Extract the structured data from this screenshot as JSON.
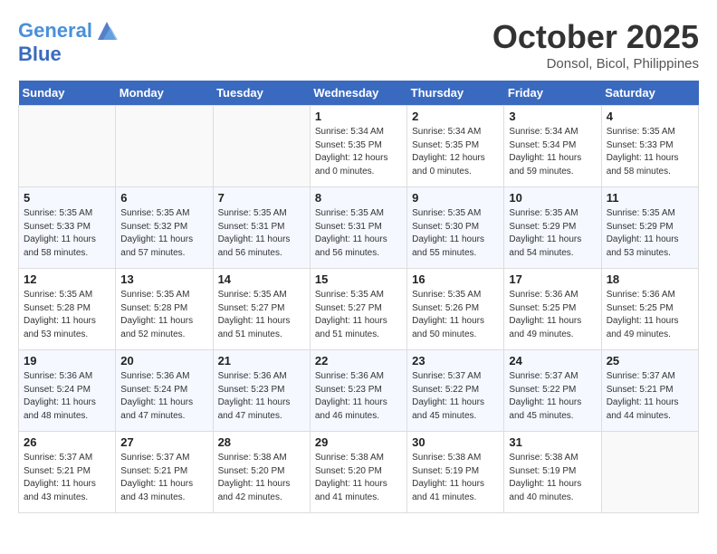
{
  "header": {
    "logo_line1": "General",
    "logo_line2": "Blue",
    "month": "October 2025",
    "location": "Donsol, Bicol, Philippines"
  },
  "weekdays": [
    "Sunday",
    "Monday",
    "Tuesday",
    "Wednesday",
    "Thursday",
    "Friday",
    "Saturday"
  ],
  "weeks": [
    [
      {
        "day": "",
        "info": ""
      },
      {
        "day": "",
        "info": ""
      },
      {
        "day": "",
        "info": ""
      },
      {
        "day": "1",
        "info": "Sunrise: 5:34 AM\nSunset: 5:35 PM\nDaylight: 12 hours\nand 0 minutes."
      },
      {
        "day": "2",
        "info": "Sunrise: 5:34 AM\nSunset: 5:35 PM\nDaylight: 12 hours\nand 0 minutes."
      },
      {
        "day": "3",
        "info": "Sunrise: 5:34 AM\nSunset: 5:34 PM\nDaylight: 11 hours\nand 59 minutes."
      },
      {
        "day": "4",
        "info": "Sunrise: 5:35 AM\nSunset: 5:33 PM\nDaylight: 11 hours\nand 58 minutes."
      }
    ],
    [
      {
        "day": "5",
        "info": "Sunrise: 5:35 AM\nSunset: 5:33 PM\nDaylight: 11 hours\nand 58 minutes."
      },
      {
        "day": "6",
        "info": "Sunrise: 5:35 AM\nSunset: 5:32 PM\nDaylight: 11 hours\nand 57 minutes."
      },
      {
        "day": "7",
        "info": "Sunrise: 5:35 AM\nSunset: 5:31 PM\nDaylight: 11 hours\nand 56 minutes."
      },
      {
        "day": "8",
        "info": "Sunrise: 5:35 AM\nSunset: 5:31 PM\nDaylight: 11 hours\nand 56 minutes."
      },
      {
        "day": "9",
        "info": "Sunrise: 5:35 AM\nSunset: 5:30 PM\nDaylight: 11 hours\nand 55 minutes."
      },
      {
        "day": "10",
        "info": "Sunrise: 5:35 AM\nSunset: 5:29 PM\nDaylight: 11 hours\nand 54 minutes."
      },
      {
        "day": "11",
        "info": "Sunrise: 5:35 AM\nSunset: 5:29 PM\nDaylight: 11 hours\nand 53 minutes."
      }
    ],
    [
      {
        "day": "12",
        "info": "Sunrise: 5:35 AM\nSunset: 5:28 PM\nDaylight: 11 hours\nand 53 minutes."
      },
      {
        "day": "13",
        "info": "Sunrise: 5:35 AM\nSunset: 5:28 PM\nDaylight: 11 hours\nand 52 minutes."
      },
      {
        "day": "14",
        "info": "Sunrise: 5:35 AM\nSunset: 5:27 PM\nDaylight: 11 hours\nand 51 minutes."
      },
      {
        "day": "15",
        "info": "Sunrise: 5:35 AM\nSunset: 5:27 PM\nDaylight: 11 hours\nand 51 minutes."
      },
      {
        "day": "16",
        "info": "Sunrise: 5:35 AM\nSunset: 5:26 PM\nDaylight: 11 hours\nand 50 minutes."
      },
      {
        "day": "17",
        "info": "Sunrise: 5:36 AM\nSunset: 5:25 PM\nDaylight: 11 hours\nand 49 minutes."
      },
      {
        "day": "18",
        "info": "Sunrise: 5:36 AM\nSunset: 5:25 PM\nDaylight: 11 hours\nand 49 minutes."
      }
    ],
    [
      {
        "day": "19",
        "info": "Sunrise: 5:36 AM\nSunset: 5:24 PM\nDaylight: 11 hours\nand 48 minutes."
      },
      {
        "day": "20",
        "info": "Sunrise: 5:36 AM\nSunset: 5:24 PM\nDaylight: 11 hours\nand 47 minutes."
      },
      {
        "day": "21",
        "info": "Sunrise: 5:36 AM\nSunset: 5:23 PM\nDaylight: 11 hours\nand 47 minutes."
      },
      {
        "day": "22",
        "info": "Sunrise: 5:36 AM\nSunset: 5:23 PM\nDaylight: 11 hours\nand 46 minutes."
      },
      {
        "day": "23",
        "info": "Sunrise: 5:37 AM\nSunset: 5:22 PM\nDaylight: 11 hours\nand 45 minutes."
      },
      {
        "day": "24",
        "info": "Sunrise: 5:37 AM\nSunset: 5:22 PM\nDaylight: 11 hours\nand 45 minutes."
      },
      {
        "day": "25",
        "info": "Sunrise: 5:37 AM\nSunset: 5:21 PM\nDaylight: 11 hours\nand 44 minutes."
      }
    ],
    [
      {
        "day": "26",
        "info": "Sunrise: 5:37 AM\nSunset: 5:21 PM\nDaylight: 11 hours\nand 43 minutes."
      },
      {
        "day": "27",
        "info": "Sunrise: 5:37 AM\nSunset: 5:21 PM\nDaylight: 11 hours\nand 43 minutes."
      },
      {
        "day": "28",
        "info": "Sunrise: 5:38 AM\nSunset: 5:20 PM\nDaylight: 11 hours\nand 42 minutes."
      },
      {
        "day": "29",
        "info": "Sunrise: 5:38 AM\nSunset: 5:20 PM\nDaylight: 11 hours\nand 41 minutes."
      },
      {
        "day": "30",
        "info": "Sunrise: 5:38 AM\nSunset: 5:19 PM\nDaylight: 11 hours\nand 41 minutes."
      },
      {
        "day": "31",
        "info": "Sunrise: 5:38 AM\nSunset: 5:19 PM\nDaylight: 11 hours\nand 40 minutes."
      },
      {
        "day": "",
        "info": ""
      }
    ]
  ]
}
